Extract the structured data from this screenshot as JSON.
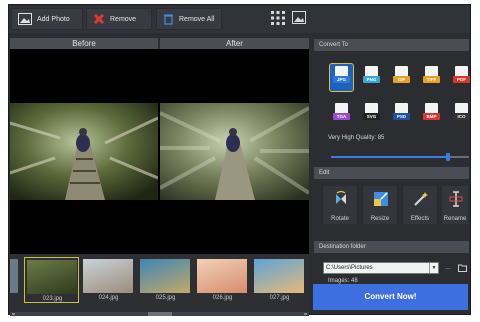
{
  "toolbar": {
    "add_photo": "Add Photo",
    "remove": "Remove",
    "remove_all": "Remove All"
  },
  "preview": {
    "before_label": "Before",
    "after_label": "After"
  },
  "thumbnails": [
    {
      "name": "023.jpg",
      "selected": true,
      "colors": [
        "#6d7a46",
        "#2f3a1f"
      ]
    },
    {
      "name": "024.jpg",
      "selected": false,
      "colors": [
        "#c9d3d9",
        "#9c8c7a"
      ]
    },
    {
      "name": "025.jpg",
      "selected": false,
      "colors": [
        "#3e86b4",
        "#c5a86a"
      ]
    },
    {
      "name": "026.jpg",
      "selected": false,
      "colors": [
        "#f0d2b8",
        "#d88b6e"
      ]
    },
    {
      "name": "027.jpg",
      "selected": false,
      "colors": [
        "#5ea3d8",
        "#e6b97a"
      ]
    }
  ],
  "convert_to": {
    "title": "Convert To",
    "formats": [
      {
        "label": "JPG",
        "color": "#2c7ad6",
        "selected": true
      },
      {
        "label": "PNG",
        "color": "#38a7d8",
        "selected": false
      },
      {
        "label": "GIF",
        "color": "#e6a128",
        "selected": false
      },
      {
        "label": "TIFF",
        "color": "#e6a128",
        "selected": false
      },
      {
        "label": "PDF",
        "color": "#d8362c",
        "selected": false
      },
      {
        "label": "TGA",
        "color": "#9a4ccf",
        "selected": false
      },
      {
        "label": "SVG",
        "color": "#222222",
        "selected": false
      },
      {
        "label": "PSD",
        "color": "#1f4f9e",
        "selected": false
      },
      {
        "label": "BMP",
        "color": "#d8362c",
        "selected": false
      },
      {
        "label": "ICO",
        "color": "#333333",
        "selected": false
      }
    ],
    "quality_label": "Very High Quality: 85",
    "quality_value": 85
  },
  "edit": {
    "title": "Edit",
    "tools": [
      "Rotate",
      "Resize",
      "Effects",
      "Rename"
    ]
  },
  "destination": {
    "title": "Destination folder",
    "path": "C:\\Users\\Pictures",
    "browse": "...",
    "images_count": "Images: 48"
  },
  "convert_button": "Convert Now!",
  "accent": "#3e6fe0"
}
